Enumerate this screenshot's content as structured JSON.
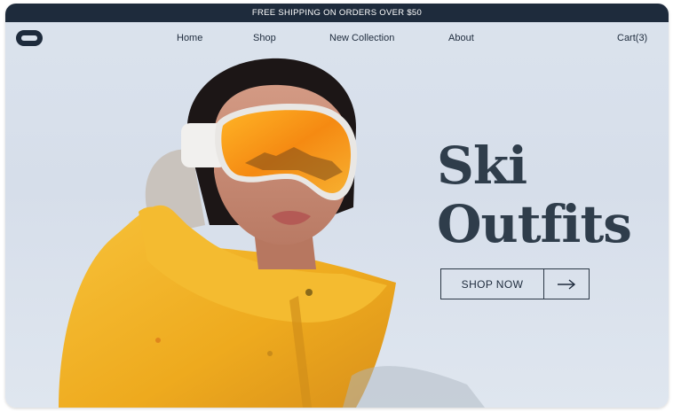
{
  "promo_bar": {
    "text": "FREE SHIPPING ON ORDERS OVER $50"
  },
  "brand": {
    "logo_icon": "s-logo-icon"
  },
  "nav": {
    "items": [
      {
        "label": "Home"
      },
      {
        "label": "Shop"
      },
      {
        "label": "New Collection"
      },
      {
        "label": "About"
      }
    ],
    "cart_label": "Cart(3)"
  },
  "hero": {
    "headline_line1": "Ski",
    "headline_line2": "Outfits",
    "cta_label": "SHOP NOW",
    "cta_icon": "arrow-right-icon",
    "image_subject": "person-in-yellow-ski-jacket-with-orange-goggles"
  },
  "colors": {
    "promo_bg": "#1e2b3c",
    "text_dark": "#2f3d4b",
    "background": "#dbe3ed",
    "jacket_yellow": "#f2b324",
    "goggle_orange": "#f5a21a"
  }
}
